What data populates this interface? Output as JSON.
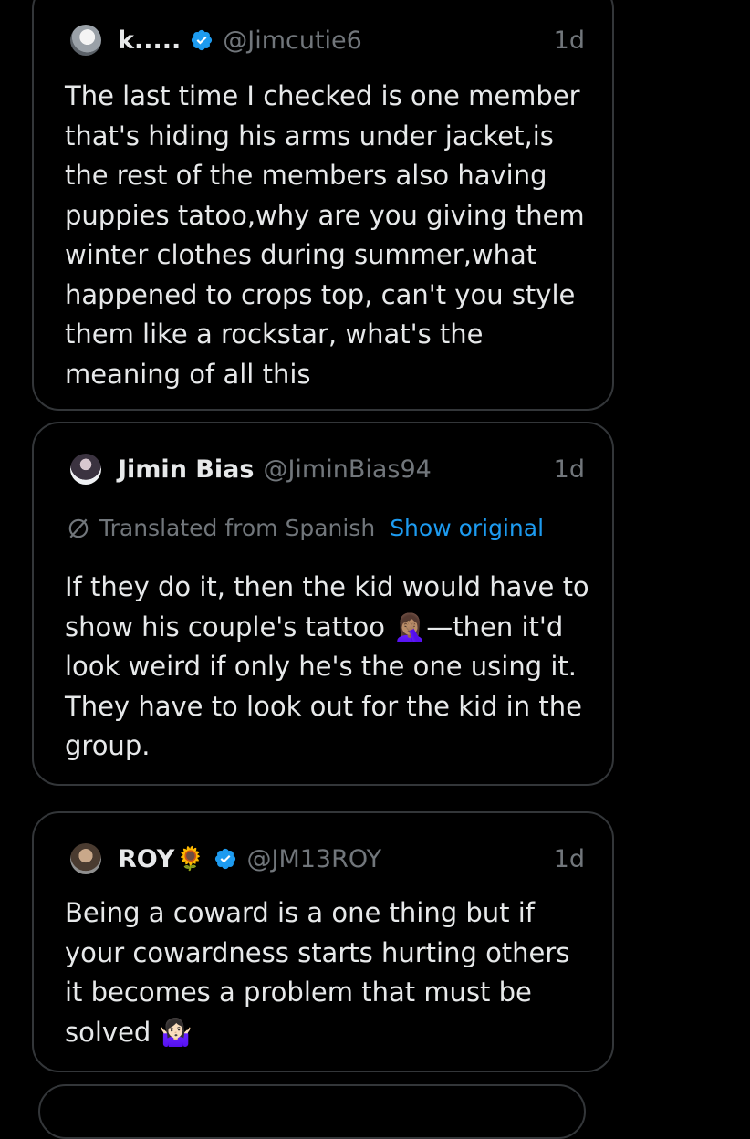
{
  "tweets": [
    {
      "display_name": "k.....",
      "name_emoji": "",
      "verified": true,
      "handle": "@Jimcutie6",
      "time": "1d",
      "translated": false,
      "lines": [
        "The last time I checked is one member",
        "that's hiding his arms under jacket,is",
        "the rest of the members also having",
        "puppies tatoo,why are you giving them",
        "winter clothes during summer,what",
        "happened to crops top, can't you style",
        "them like a rockstar, what's the",
        "meaning of all this"
      ]
    },
    {
      "display_name": "Jimin Bias",
      "name_emoji": "",
      "verified": false,
      "handle": "@JiminBias94",
      "time": "1d",
      "translated": true,
      "translated_label": "Translated from Spanish",
      "show_original_label": "Show original",
      "lines": [
        "If they do it, then the kid would have to",
        "show his couple's tattoo 🤦🏽‍♀️—then it'd",
        "look weird if only he's the one using it.",
        "They have to look out for the kid in the",
        "group."
      ]
    },
    {
      "display_name": "ROY",
      "name_emoji": "🌻",
      "verified": true,
      "handle": "@JM13ROY",
      "time": "1d",
      "translated": false,
      "lines": [
        "Being a coward is a one thing but if",
        "your cowardness starts hurting others",
        "it becomes a problem that must be",
        "solved 🤷🏻‍♀️"
      ]
    }
  ],
  "colors": {
    "background": "#000000",
    "text": "#e7e9ea",
    "muted": "#71767b",
    "link": "#1d9bf0",
    "border": "#333639",
    "verified_badge": "#1d9bf0"
  },
  "icons": {
    "verified": "verified-badge-icon",
    "translate": "translate-icon"
  }
}
